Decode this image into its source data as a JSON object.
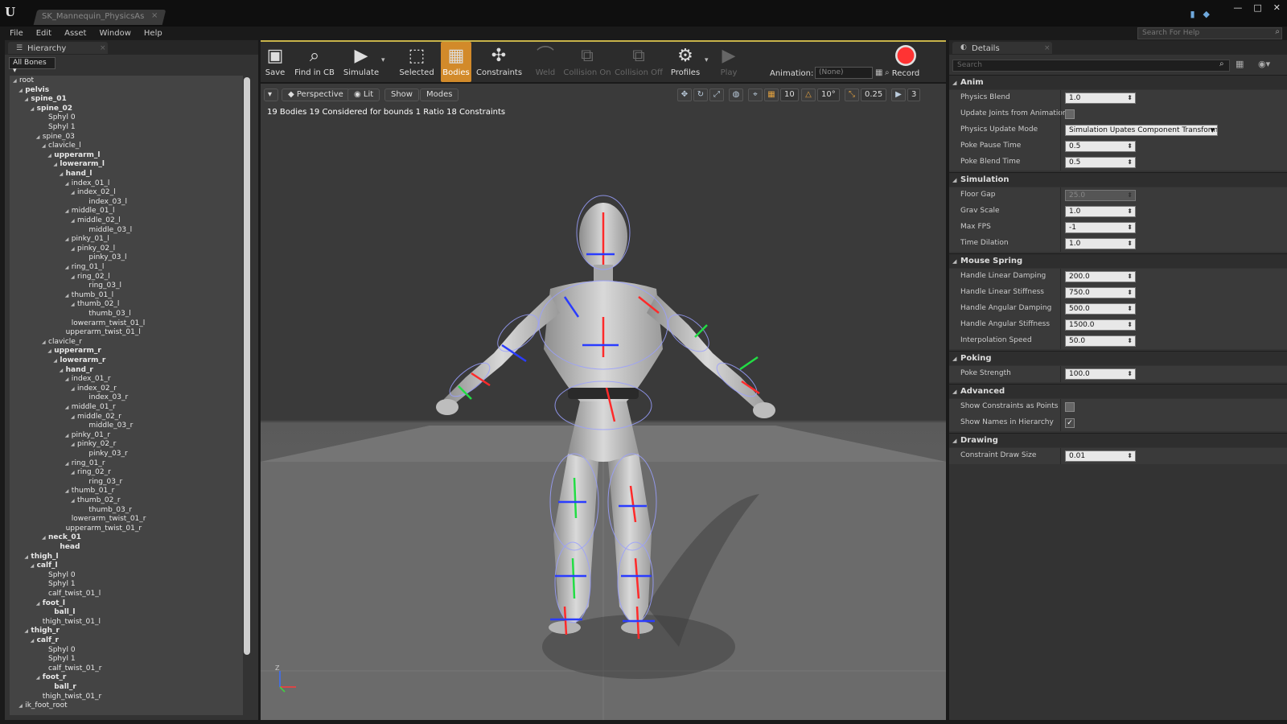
{
  "window": {
    "tab_title": "SK_Mannequin_PhysicsAs",
    "close_glyph": "×",
    "minimize_glyph": "—",
    "maximize_glyph": "□",
    "window_close_glyph": "✕"
  },
  "menu": [
    "File",
    "Edit",
    "Asset",
    "Window",
    "Help"
  ],
  "help_search": {
    "placeholder": "Search For Help"
  },
  "hierarchy": {
    "tab_label": "Hierarchy",
    "filter_label": "All Bones",
    "bones": [
      {
        "label": "root",
        "depth": 0,
        "bold": false,
        "expander": true
      },
      {
        "label": "pelvis",
        "depth": 1,
        "bold": true,
        "expander": true
      },
      {
        "label": "spine_01",
        "depth": 2,
        "bold": true,
        "expander": true
      },
      {
        "label": "spine_02",
        "depth": 3,
        "bold": true,
        "expander": true
      },
      {
        "label": "Sphyl 0",
        "depth": 5,
        "bold": false,
        "expander": false
      },
      {
        "label": "Sphyl 1",
        "depth": 5,
        "bold": false,
        "expander": false
      },
      {
        "label": "spine_03",
        "depth": 4,
        "bold": false,
        "expander": true
      },
      {
        "label": "clavicle_l",
        "depth": 5,
        "bold": false,
        "expander": true
      },
      {
        "label": "upperarm_l",
        "depth": 6,
        "bold": true,
        "expander": true
      },
      {
        "label": "lowerarm_l",
        "depth": 7,
        "bold": true,
        "expander": true
      },
      {
        "label": "hand_l",
        "depth": 8,
        "bold": true,
        "expander": true
      },
      {
        "label": "index_01_l",
        "depth": 9,
        "bold": false,
        "expander": true
      },
      {
        "label": "index_02_l",
        "depth": 10,
        "bold": false,
        "expander": true
      },
      {
        "label": "index_03_l",
        "depth": 12,
        "bold": false,
        "expander": false
      },
      {
        "label": "middle_01_l",
        "depth": 9,
        "bold": false,
        "expander": true
      },
      {
        "label": "middle_02_l",
        "depth": 10,
        "bold": false,
        "expander": true
      },
      {
        "label": "middle_03_l",
        "depth": 12,
        "bold": false,
        "expander": false
      },
      {
        "label": "pinky_01_l",
        "depth": 9,
        "bold": false,
        "expander": true
      },
      {
        "label": "pinky_02_l",
        "depth": 10,
        "bold": false,
        "expander": true
      },
      {
        "label": "pinky_03_l",
        "depth": 12,
        "bold": false,
        "expander": false
      },
      {
        "label": "ring_01_l",
        "depth": 9,
        "bold": false,
        "expander": true
      },
      {
        "label": "ring_02_l",
        "depth": 10,
        "bold": false,
        "expander": true
      },
      {
        "label": "ring_03_l",
        "depth": 12,
        "bold": false,
        "expander": false
      },
      {
        "label": "thumb_01_l",
        "depth": 9,
        "bold": false,
        "expander": true
      },
      {
        "label": "thumb_02_l",
        "depth": 10,
        "bold": false,
        "expander": true
      },
      {
        "label": "thumb_03_l",
        "depth": 12,
        "bold": false,
        "expander": false
      },
      {
        "label": "lowerarm_twist_01_l",
        "depth": 9,
        "bold": false,
        "expander": false
      },
      {
        "label": "upperarm_twist_01_l",
        "depth": 8,
        "bold": false,
        "expander": false
      },
      {
        "label": "clavicle_r",
        "depth": 5,
        "bold": false,
        "expander": true
      },
      {
        "label": "upperarm_r",
        "depth": 6,
        "bold": true,
        "expander": true
      },
      {
        "label": "lowerarm_r",
        "depth": 7,
        "bold": true,
        "expander": true
      },
      {
        "label": "hand_r",
        "depth": 8,
        "bold": true,
        "expander": true
      },
      {
        "label": "index_01_r",
        "depth": 9,
        "bold": false,
        "expander": true
      },
      {
        "label": "index_02_r",
        "depth": 10,
        "bold": false,
        "expander": true
      },
      {
        "label": "index_03_r",
        "depth": 12,
        "bold": false,
        "expander": false
      },
      {
        "label": "middle_01_r",
        "depth": 9,
        "bold": false,
        "expander": true
      },
      {
        "label": "middle_02_r",
        "depth": 10,
        "bold": false,
        "expander": true
      },
      {
        "label": "middle_03_r",
        "depth": 12,
        "bold": false,
        "expander": false
      },
      {
        "label": "pinky_01_r",
        "depth": 9,
        "bold": false,
        "expander": true
      },
      {
        "label": "pinky_02_r",
        "depth": 10,
        "bold": false,
        "expander": true
      },
      {
        "label": "pinky_03_r",
        "depth": 12,
        "bold": false,
        "expander": false
      },
      {
        "label": "ring_01_r",
        "depth": 9,
        "bold": false,
        "expander": true
      },
      {
        "label": "ring_02_r",
        "depth": 10,
        "bold": false,
        "expander": true
      },
      {
        "label": "ring_03_r",
        "depth": 12,
        "bold": false,
        "expander": false
      },
      {
        "label": "thumb_01_r",
        "depth": 9,
        "bold": false,
        "expander": true
      },
      {
        "label": "thumb_02_r",
        "depth": 10,
        "bold": false,
        "expander": true
      },
      {
        "label": "thumb_03_r",
        "depth": 12,
        "bold": false,
        "expander": false
      },
      {
        "label": "lowerarm_twist_01_r",
        "depth": 9,
        "bold": false,
        "expander": false
      },
      {
        "label": "upperarm_twist_01_r",
        "depth": 8,
        "bold": false,
        "expander": false
      },
      {
        "label": "neck_01",
        "depth": 5,
        "bold": true,
        "expander": true
      },
      {
        "label": "head",
        "depth": 7,
        "bold": true,
        "expander": false
      },
      {
        "label": "thigh_l",
        "depth": 2,
        "bold": true,
        "expander": true
      },
      {
        "label": "calf_l",
        "depth": 3,
        "bold": true,
        "expander": true
      },
      {
        "label": "Sphyl 0",
        "depth": 5,
        "bold": false,
        "expander": false
      },
      {
        "label": "Sphyl 1",
        "depth": 5,
        "bold": false,
        "expander": false
      },
      {
        "label": "calf_twist_01_l",
        "depth": 5,
        "bold": false,
        "expander": false
      },
      {
        "label": "foot_l",
        "depth": 4,
        "bold": true,
        "expander": true
      },
      {
        "label": "ball_l",
        "depth": 6,
        "bold": true,
        "expander": false
      },
      {
        "label": "thigh_twist_01_l",
        "depth": 4,
        "bold": false,
        "expander": false
      },
      {
        "label": "thigh_r",
        "depth": 2,
        "bold": true,
        "expander": true
      },
      {
        "label": "calf_r",
        "depth": 3,
        "bold": true,
        "expander": true
      },
      {
        "label": "Sphyl 0",
        "depth": 5,
        "bold": false,
        "expander": false
      },
      {
        "label": "Sphyl 1",
        "depth": 5,
        "bold": false,
        "expander": false
      },
      {
        "label": "calf_twist_01_r",
        "depth": 5,
        "bold": false,
        "expander": false
      },
      {
        "label": "foot_r",
        "depth": 4,
        "bold": true,
        "expander": true
      },
      {
        "label": "ball_r",
        "depth": 6,
        "bold": true,
        "expander": false
      },
      {
        "label": "thigh_twist_01_r",
        "depth": 4,
        "bold": false,
        "expander": false
      },
      {
        "label": "ik_foot_root",
        "depth": 1,
        "bold": false,
        "expander": true
      }
    ]
  },
  "toolbar": {
    "buttons": [
      {
        "id": "save",
        "label": "Save",
        "icon": "save-icon",
        "glyph": "▣",
        "state": "normal"
      },
      {
        "id": "find-in-cb",
        "label": "Find in CB",
        "icon": "magnifier-icon",
        "glyph": "⌕",
        "state": "normal"
      },
      {
        "id": "simulate",
        "label": "Simulate",
        "icon": "simulate-icon",
        "glyph": "▶",
        "state": "normal"
      },
      {
        "id": "selected",
        "label": "Selected",
        "icon": "selected-icon",
        "glyph": "⬚",
        "state": "normal"
      },
      {
        "id": "bodies",
        "label": "Bodies",
        "icon": "bodies-icon",
        "glyph": "▦",
        "state": "active"
      },
      {
        "id": "constraints",
        "label": "Constraints",
        "icon": "constraints-icon",
        "glyph": "✣",
        "state": "normal"
      },
      {
        "id": "weld",
        "label": "Weld",
        "icon": "weld-icon",
        "glyph": "⌒",
        "state": "disabled"
      },
      {
        "id": "collision-on",
        "label": "Collision On",
        "icon": "collision-on-icon",
        "glyph": "⧉",
        "state": "disabled"
      },
      {
        "id": "collision-off",
        "label": "Collision Off",
        "icon": "collision-off-icon",
        "glyph": "⧉",
        "state": "disabled"
      },
      {
        "id": "profiles",
        "label": "Profiles",
        "icon": "profiles-icon",
        "glyph": "⚙",
        "state": "normal"
      },
      {
        "id": "play",
        "label": "Play",
        "icon": "play-icon",
        "glyph": "▶",
        "state": "disabled"
      }
    ],
    "animation_label": "Animation:",
    "animation_value": "(None)",
    "record_label": "Record",
    "dropdown_glyph": "▾",
    "grid_glyph": "▦",
    "search_glyph": "⌕"
  },
  "viewport": {
    "menu_glyph": "▾",
    "perspective_label": "Perspective",
    "lit_label": "Lit",
    "show_label": "Show",
    "modes_label": "Modes",
    "grid_snap": "10",
    "rotation_snap": "10°",
    "scale_snap": "0.25",
    "camera_speed": "3",
    "stats": "19 Bodies  19 Considered for bounds  1 Ratio  18 Constraints",
    "axis_z": "Z"
  },
  "details": {
    "tab_label": "Details",
    "search_placeholder": "Search",
    "categories": [
      {
        "name": "Anim",
        "props": [
          {
            "label": "Physics Blend",
            "type": "number",
            "value": "1.0"
          },
          {
            "label": "Update Joints from Animation",
            "type": "check",
            "checked": false
          },
          {
            "label": "Physics Update Mode",
            "type": "combo",
            "value": "Simulation Upates Component Transform"
          },
          {
            "label": "Poke Pause Time",
            "type": "number",
            "value": "0.5"
          },
          {
            "label": "Poke Blend Time",
            "type": "number",
            "value": "0.5"
          }
        ]
      },
      {
        "name": "Simulation",
        "props": [
          {
            "label": "Floor Gap",
            "type": "number",
            "value": "25.0",
            "disabled": true
          },
          {
            "label": "Grav Scale",
            "type": "number",
            "value": "1.0"
          },
          {
            "label": "Max FPS",
            "type": "number",
            "value": "-1"
          },
          {
            "label": "Time Dilation",
            "type": "number",
            "value": "1.0"
          }
        ]
      },
      {
        "name": "Mouse Spring",
        "props": [
          {
            "label": "Handle Linear Damping",
            "type": "number",
            "value": "200.0"
          },
          {
            "label": "Handle Linear Stiffness",
            "type": "number",
            "value": "750.0"
          },
          {
            "label": "Handle Angular Damping",
            "type": "number",
            "value": "500.0"
          },
          {
            "label": "Handle Angular Stiffness",
            "type": "number",
            "value": "1500.0"
          },
          {
            "label": "Interpolation Speed",
            "type": "number",
            "value": "50.0"
          }
        ]
      },
      {
        "name": "Poking",
        "props": [
          {
            "label": "Poke Strength",
            "type": "number",
            "value": "100.0"
          }
        ]
      },
      {
        "name": "Advanced",
        "props": [
          {
            "label": "Show Constraints as Points",
            "type": "check",
            "checked": false
          },
          {
            "label": "Show Names in Hierarchy",
            "type": "check",
            "checked": true
          }
        ]
      },
      {
        "name": "Drawing",
        "props": [
          {
            "label": "Constraint Draw Size",
            "type": "number",
            "value": "0.01"
          }
        ]
      }
    ]
  },
  "colors": {
    "accent_active": "#d28a2a",
    "record_red": "#ff3333",
    "bone_red": "#ff2a2a",
    "bone_blue": "#2a3cff",
    "bone_green": "#22dd44",
    "body_wire": "#9aa0ff"
  }
}
